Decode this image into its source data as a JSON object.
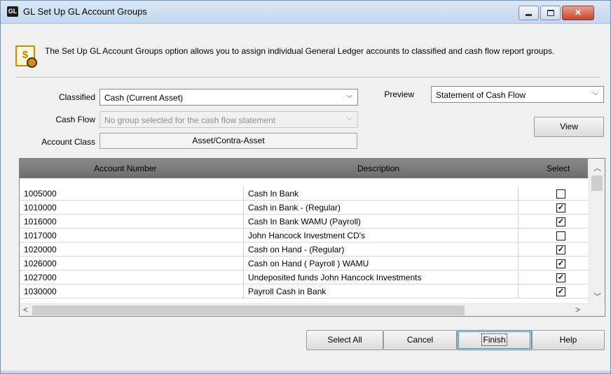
{
  "window": {
    "title": "GL Set Up GL Account Groups",
    "app_icon_text": "GL",
    "buttons": [
      "minimize",
      "maximize",
      "close"
    ]
  },
  "info": {
    "icon": "dollar-document-icon",
    "text": "The Set Up GL Account Groups option allows you to assign individual General Ledger accounts to classified and cash flow report groups."
  },
  "form": {
    "classified_label": "Classified",
    "classified_value": "Cash (Current Asset)",
    "cashflow_label": "Cash Flow",
    "cashflow_value": "No group selected for the cash flow statement",
    "account_class_label": "Account Class",
    "account_class_value": "Asset/Contra-Asset",
    "preview_label": "Preview",
    "preview_value": "Statement of Cash Flow",
    "view_button": "View"
  },
  "grid": {
    "columns": [
      "Account Number",
      "Description",
      "Select"
    ],
    "rows": [
      {
        "account": "1005000",
        "description": "Cash In Bank",
        "selected": false
      },
      {
        "account": "1010000",
        "description": "Cash in Bank - (Regular)",
        "selected": true
      },
      {
        "account": "1016000",
        "description": "Cash In Bank WAMU (Payroll)",
        "selected": true
      },
      {
        "account": "1017000",
        "description": "John Hancock Investment CD's",
        "selected": false
      },
      {
        "account": "1020000",
        "description": "Cash on Hand - (Regular)",
        "selected": true
      },
      {
        "account": "1026000",
        "description": "Cash on Hand ( Payroll ) WAMU",
        "selected": true
      },
      {
        "account": "1027000",
        "description": "Undeposited funds John Hancock Investments",
        "selected": true
      },
      {
        "account": "1030000",
        "description": "Payroll Cash in Bank",
        "selected": true
      }
    ]
  },
  "actions": {
    "select_all": "Select All",
    "cancel": "Cancel",
    "finish": "Finish",
    "help": "Help"
  },
  "colors": {
    "title_bar": "#c4d7ee",
    "grid_header": "#7c7c7c",
    "close_button": "#c7452f"
  }
}
